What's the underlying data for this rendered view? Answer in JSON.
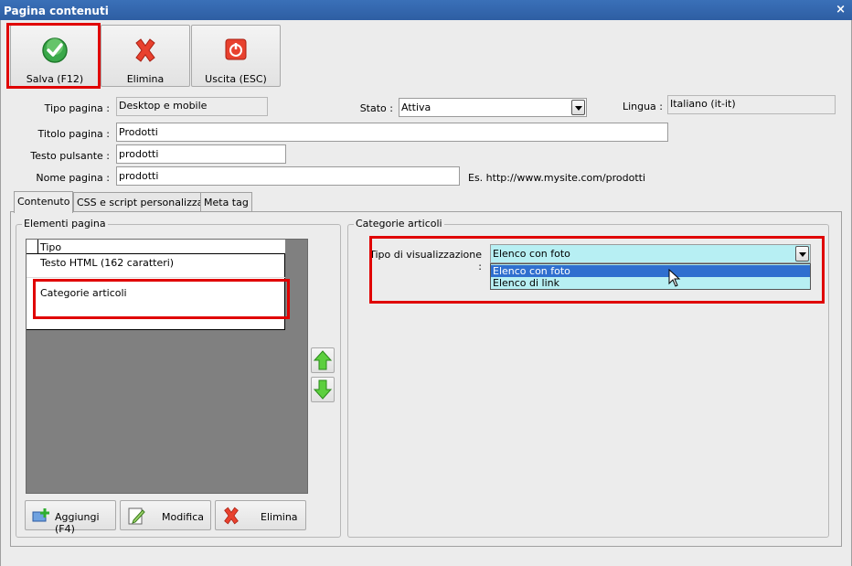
{
  "window": {
    "title": "Pagina contenuti",
    "close_label": "×"
  },
  "toolbar": {
    "save_label": "Salva (F12)",
    "delete_label": "Elimina",
    "exit_label": "Uscita (ESC)"
  },
  "form": {
    "page_type_label": "Tipo pagina :",
    "page_type_value": "Desktop e mobile",
    "state_label": "Stato :",
    "state_value": "Attiva",
    "language_label": "Lingua :",
    "language_value": "Italiano (it-it)",
    "page_title_label": "Titolo pagina :",
    "page_title_value": "Prodotti",
    "button_text_label": "Testo pulsante :",
    "button_text_value": "prodotti",
    "page_name_label": "Nome pagina :",
    "page_name_value": "prodotti",
    "url_hint": "Es. http://www.mysite.com/prodotti"
  },
  "tabs": [
    {
      "label": "Contenuto",
      "active": true
    },
    {
      "label": "CSS e script personalizzati",
      "active": false
    },
    {
      "label": "Meta tag",
      "active": false
    }
  ],
  "elements_panel": {
    "title": "Elementi pagina",
    "column_header": "Tipo",
    "rows": [
      "Testo HTML (162 caratteri)",
      "Categorie articoli"
    ]
  },
  "bottom_buttons": {
    "add_label": "Aggiungi (F4)",
    "edit_label": "Modifica",
    "delete_label": "Elimina"
  },
  "categories_panel": {
    "title": "Categorie articoli",
    "display_type_label": "Tipo di visualizzazione :",
    "display_type_value": "Elenco con foto",
    "options": [
      "Elenco con foto",
      "Elenco di link"
    ],
    "selected_option": "Elenco con foto"
  },
  "colors": {
    "titlebar": "#2e5ea3",
    "highlight": "#e00000",
    "dropdown_bg": "#b7eff3",
    "selection": "#2f6fcf"
  }
}
